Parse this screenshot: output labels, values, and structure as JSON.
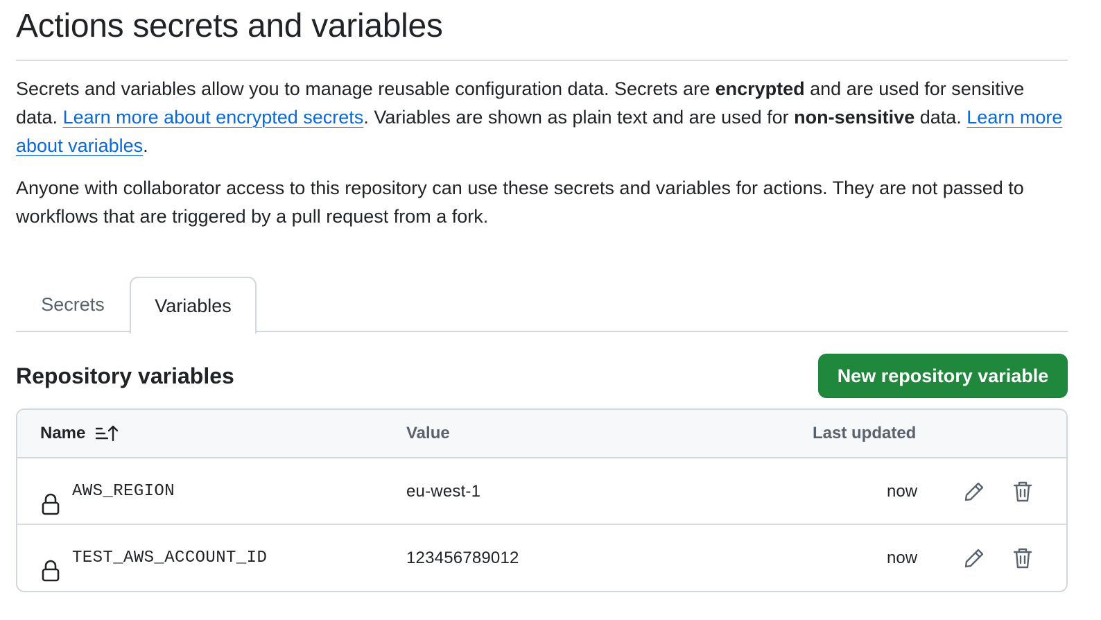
{
  "page": {
    "title": "Actions secrets and variables"
  },
  "description": {
    "p1_a": "Secrets and variables allow you to manage reusable configuration data. Secrets are ",
    "p1_bold1": "encrypted",
    "p1_b": " and are used for sensitive data. ",
    "link_secrets": "Learn more about encrypted secrets",
    "p1_c": ". Variables are shown as plain text and are used for ",
    "p1_bold2": "non-sensitive",
    "p1_d": " data. ",
    "link_variables": "Learn more about variables",
    "p1_e": ".",
    "p2": "Anyone with collaborator access to this repository can use these secrets and variables for actions. They are not passed to workflows that are triggered by a pull request from a fork."
  },
  "tabs": [
    {
      "label": "Secrets",
      "selected": false
    },
    {
      "label": "Variables",
      "selected": true
    }
  ],
  "section": {
    "title": "Repository variables",
    "new_button": "New repository variable"
  },
  "table": {
    "columns": {
      "name": "Name",
      "value": "Value",
      "updated": "Last updated"
    },
    "rows": [
      {
        "name": "AWS_REGION",
        "value": "eu-west-1",
        "updated": "now"
      },
      {
        "name": "TEST_AWS_ACCOUNT_ID",
        "value": "123456789012",
        "updated": "now"
      }
    ]
  },
  "colors": {
    "accent_link": "#0969da",
    "button_green": "#1f883d",
    "muted_text": "#59636e",
    "border": "#d0d7de"
  },
  "icons": {
    "sort": "sort-ascending-icon",
    "lock": "lock-icon",
    "edit": "pencil-icon",
    "delete": "trash-icon"
  }
}
